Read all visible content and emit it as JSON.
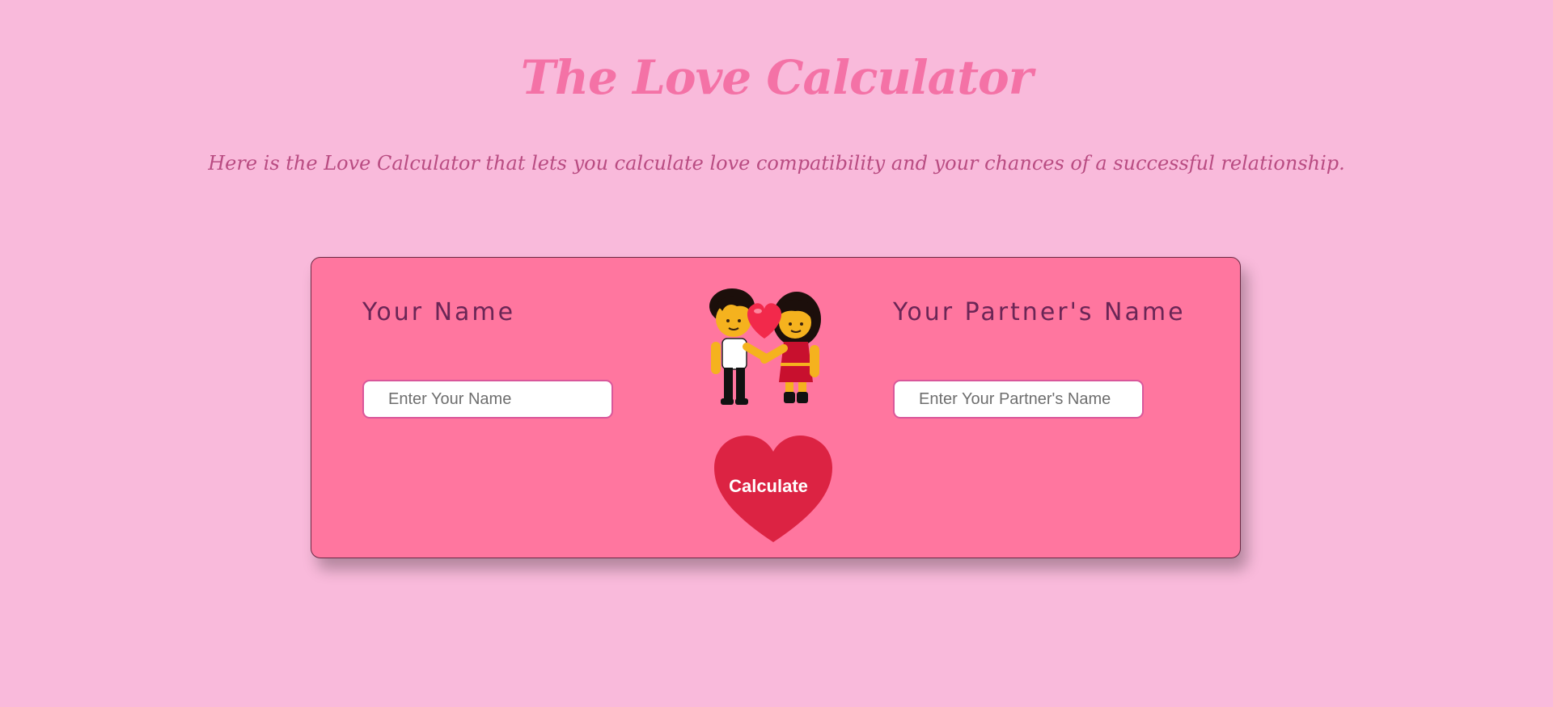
{
  "header": {
    "title": "The Love Calculator",
    "subtitle": "Here is the Love Calculator that lets you calculate love compatibility and your chances of a successful relationship."
  },
  "form": {
    "your_name_label": "Your Name",
    "partner_name_label": "Your Partner's Name",
    "your_name_placeholder": "Enter Your Name",
    "partner_name_placeholder": "Enter Your Partner's Name",
    "calculate_label": "Calculate",
    "image": "couple-holding-hands-with-heart"
  },
  "colors": {
    "background": "#f9badb",
    "title": "#f472a6",
    "subtitle": "#b94c82",
    "card": "#ff769f",
    "label": "#6b2656",
    "button_heart": "#dc2343"
  }
}
